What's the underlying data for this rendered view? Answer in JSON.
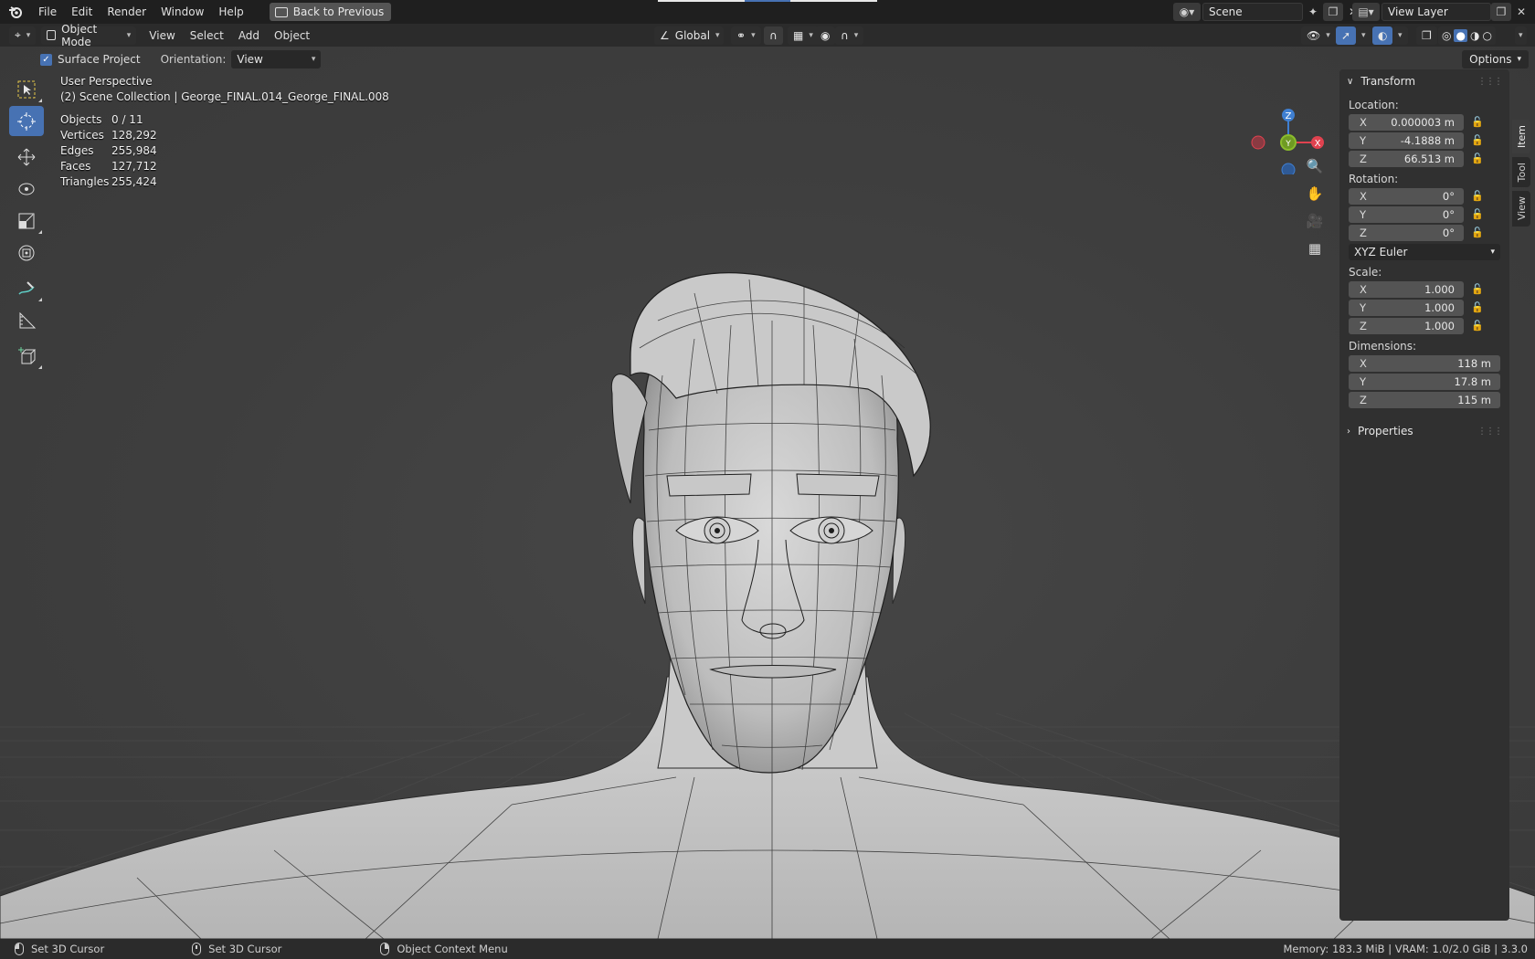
{
  "topbar": {
    "menus": [
      "File",
      "Edit",
      "Render",
      "Window",
      "Help"
    ],
    "back_label": "Back to Previous",
    "scene_name": "Scene",
    "view_layer": "View Layer"
  },
  "header": {
    "mode": "Object Mode",
    "menus": [
      "View",
      "Select",
      "Add",
      "Object"
    ],
    "transform_orientation": "Global"
  },
  "tool_settings": {
    "surface_project_label": "Surface Project",
    "surface_project_checked": true,
    "orientation_label": "Orientation:",
    "orientation_value": "View",
    "options_label": "Options"
  },
  "overlay": {
    "view_name": "User Perspective",
    "collection": "(2) Scene Collection | George_FINAL.014_George_FINAL.008",
    "stats": [
      {
        "label": "Objects",
        "value": "0 / 11"
      },
      {
        "label": "Vertices",
        "value": "128,292"
      },
      {
        "label": "Edges",
        "value": "255,984"
      },
      {
        "label": "Faces",
        "value": "127,712"
      },
      {
        "label": "Triangles",
        "value": "255,424"
      }
    ]
  },
  "gizmo": {
    "x": "X",
    "y": "Y",
    "z": "Z",
    "x_color": "#e0424f",
    "y_color": "#8bbd2c",
    "z_color": "#3f7fd1"
  },
  "npanel": {
    "transform_title": "Transform",
    "location_label": "Location:",
    "location": [
      {
        "axis": "X",
        "value": "0.000003 m"
      },
      {
        "axis": "Y",
        "value": "-4.1888 m"
      },
      {
        "axis": "Z",
        "value": "66.513 m"
      }
    ],
    "rotation_label": "Rotation:",
    "rotation": [
      {
        "axis": "X",
        "value": "0°"
      },
      {
        "axis": "Y",
        "value": "0°"
      },
      {
        "axis": "Z",
        "value": "0°"
      }
    ],
    "rotation_mode": "XYZ Euler",
    "scale_label": "Scale:",
    "scale": [
      {
        "axis": "X",
        "value": "1.000"
      },
      {
        "axis": "Y",
        "value": "1.000"
      },
      {
        "axis": "Z",
        "value": "1.000"
      }
    ],
    "dimensions_label": "Dimensions:",
    "dimensions": [
      {
        "axis": "X",
        "value": "118 m"
      },
      {
        "axis": "Y",
        "value": "17.8 m"
      },
      {
        "axis": "Z",
        "value": "115 m"
      }
    ],
    "properties_title": "Properties",
    "tabs": [
      "Item",
      "Tool",
      "View"
    ]
  },
  "statusbar": {
    "left_click": "Set 3D Cursor",
    "middle_click": "Set 3D Cursor",
    "right_click": "Object Context Menu",
    "info": "Memory: 183.3 MiB | VRAM: 1.0/2.0 GiB | 3.3.0"
  },
  "accent_color": "#4772b3"
}
